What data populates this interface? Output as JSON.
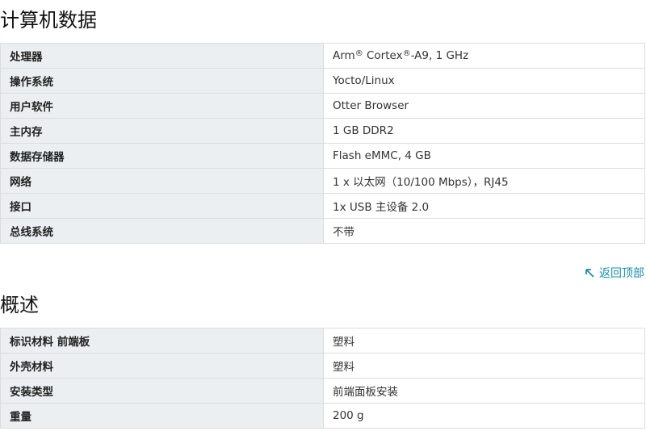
{
  "section1": {
    "title": "计算机数据",
    "rows": [
      {
        "label": "处理器",
        "value_parts": [
          "Arm",
          "®",
          " Cortex",
          "®",
          "-A9, 1 GHz"
        ]
      },
      {
        "label": "操作系统",
        "value": "Yocto/Linux"
      },
      {
        "label": "用户软件",
        "value": "Otter Browser"
      },
      {
        "label": "主内存",
        "value": "1 GB DDR2"
      },
      {
        "label": "数据存储器",
        "value": "Flash eMMC, 4 GB"
      },
      {
        "label": "网络",
        "value": "1 x 以太网（10/100 Mbps），RJ45"
      },
      {
        "label": "接口",
        "value": "1x USB 主设备 2.0"
      },
      {
        "label": "总线系统",
        "value": "不带"
      }
    ]
  },
  "back_to_top": {
    "label": "返回顶部",
    "icon": "arrow-up-left-icon",
    "color": "#1a8fb0"
  },
  "section2": {
    "title": "概述",
    "rows": [
      {
        "label": "标识材料 前端板",
        "value": "塑料"
      },
      {
        "label": "外壳材料",
        "value": "塑料"
      },
      {
        "label": "安装类型",
        "value": "前端面板安装"
      },
      {
        "label": "重量",
        "value": "200 g"
      }
    ]
  }
}
